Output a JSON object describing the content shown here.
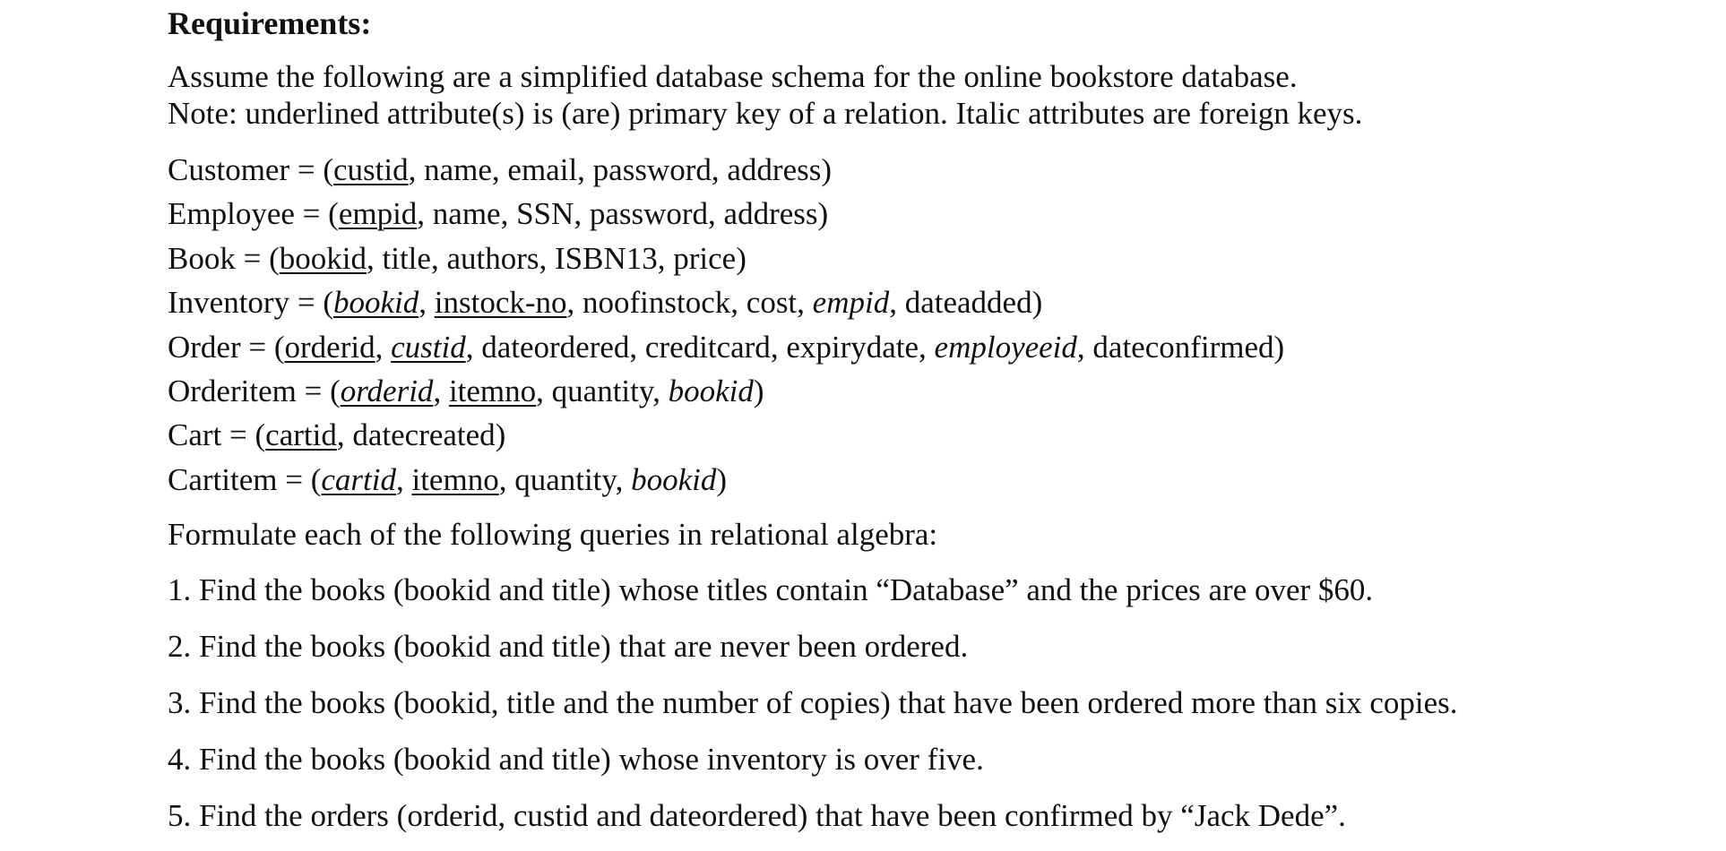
{
  "heading": "Requirements:",
  "intro": [
    "Assume the following are a simplified database schema for the online bookstore database.",
    "Note: underlined attribute(s) is (are) primary key of a relation. Italic attributes are foreign keys."
  ],
  "schema": [
    {
      "relation": "Customer",
      "attributes": [
        {
          "name": "custid",
          "pk": true,
          "fk": false
        },
        {
          "name": "name",
          "pk": false,
          "fk": false
        },
        {
          "name": "email",
          "pk": false,
          "fk": false
        },
        {
          "name": "password",
          "pk": false,
          "fk": false
        },
        {
          "name": "address",
          "pk": false,
          "fk": false
        }
      ]
    },
    {
      "relation": "Employee",
      "attributes": [
        {
          "name": "empid",
          "pk": true,
          "fk": false
        },
        {
          "name": "name",
          "pk": false,
          "fk": false
        },
        {
          "name": "SSN",
          "pk": false,
          "fk": false
        },
        {
          "name": "password",
          "pk": false,
          "fk": false
        },
        {
          "name": "address",
          "pk": false,
          "fk": false
        }
      ]
    },
    {
      "relation": "Book",
      "attributes": [
        {
          "name": "bookid",
          "pk": true,
          "fk": false
        },
        {
          "name": "title",
          "pk": false,
          "fk": false
        },
        {
          "name": "authors",
          "pk": false,
          "fk": false
        },
        {
          "name": "ISBN13",
          "pk": false,
          "fk": false
        },
        {
          "name": "price",
          "pk": false,
          "fk": false
        }
      ]
    },
    {
      "relation": "Inventory",
      "attributes": [
        {
          "name": "bookid",
          "pk": true,
          "fk": true
        },
        {
          "name": "instock-no",
          "pk": true,
          "fk": false
        },
        {
          "name": "noofinstock",
          "pk": false,
          "fk": false
        },
        {
          "name": "cost",
          "pk": false,
          "fk": false
        },
        {
          "name": "empid",
          "pk": false,
          "fk": true
        },
        {
          "name": "dateadded",
          "pk": false,
          "fk": false
        }
      ]
    },
    {
      "relation": "Order",
      "attributes": [
        {
          "name": "orderid",
          "pk": true,
          "fk": false
        },
        {
          "name": "custid",
          "pk": true,
          "fk": true
        },
        {
          "name": "dateordered",
          "pk": false,
          "fk": false
        },
        {
          "name": "creditcard",
          "pk": false,
          "fk": false
        },
        {
          "name": "expirydate",
          "pk": false,
          "fk": false
        },
        {
          "name": "employeeid",
          "pk": false,
          "fk": true
        },
        {
          "name": "dateconfirmed",
          "pk": false,
          "fk": false
        }
      ]
    },
    {
      "relation": "Orderitem",
      "attributes": [
        {
          "name": "orderid",
          "pk": true,
          "fk": true
        },
        {
          "name": "itemno",
          "pk": true,
          "fk": false
        },
        {
          "name": "quantity",
          "pk": false,
          "fk": false
        },
        {
          "name": "bookid",
          "pk": false,
          "fk": true
        }
      ]
    },
    {
      "relation": "Cart",
      "attributes": [
        {
          "name": "cartid",
          "pk": true,
          "fk": false
        },
        {
          "name": "datecreated",
          "pk": false,
          "fk": false
        }
      ]
    },
    {
      "relation": "Cartitem",
      "attributes": [
        {
          "name": "cartid",
          "pk": true,
          "fk": true
        },
        {
          "name": "itemno",
          "pk": true,
          "fk": false
        },
        {
          "name": "quantity",
          "pk": false,
          "fk": false
        },
        {
          "name": "bookid",
          "pk": false,
          "fk": true
        }
      ]
    }
  ],
  "instruction": "Formulate each of the following queries in relational algebra:",
  "queries": [
    "1. Find the books (bookid and title) whose titles contain “Database” and the prices are over $60.",
    "2. Find the books (bookid and title) that are never been ordered.",
    "3. Find the books (bookid, title and the number of copies) that have been ordered more than six copies.",
    "4. Find the books (bookid and title) whose inventory is over five.",
    "5. Find the orders (orderid, custid and dateordered) that have been confirmed by “Jack Dede”."
  ]
}
